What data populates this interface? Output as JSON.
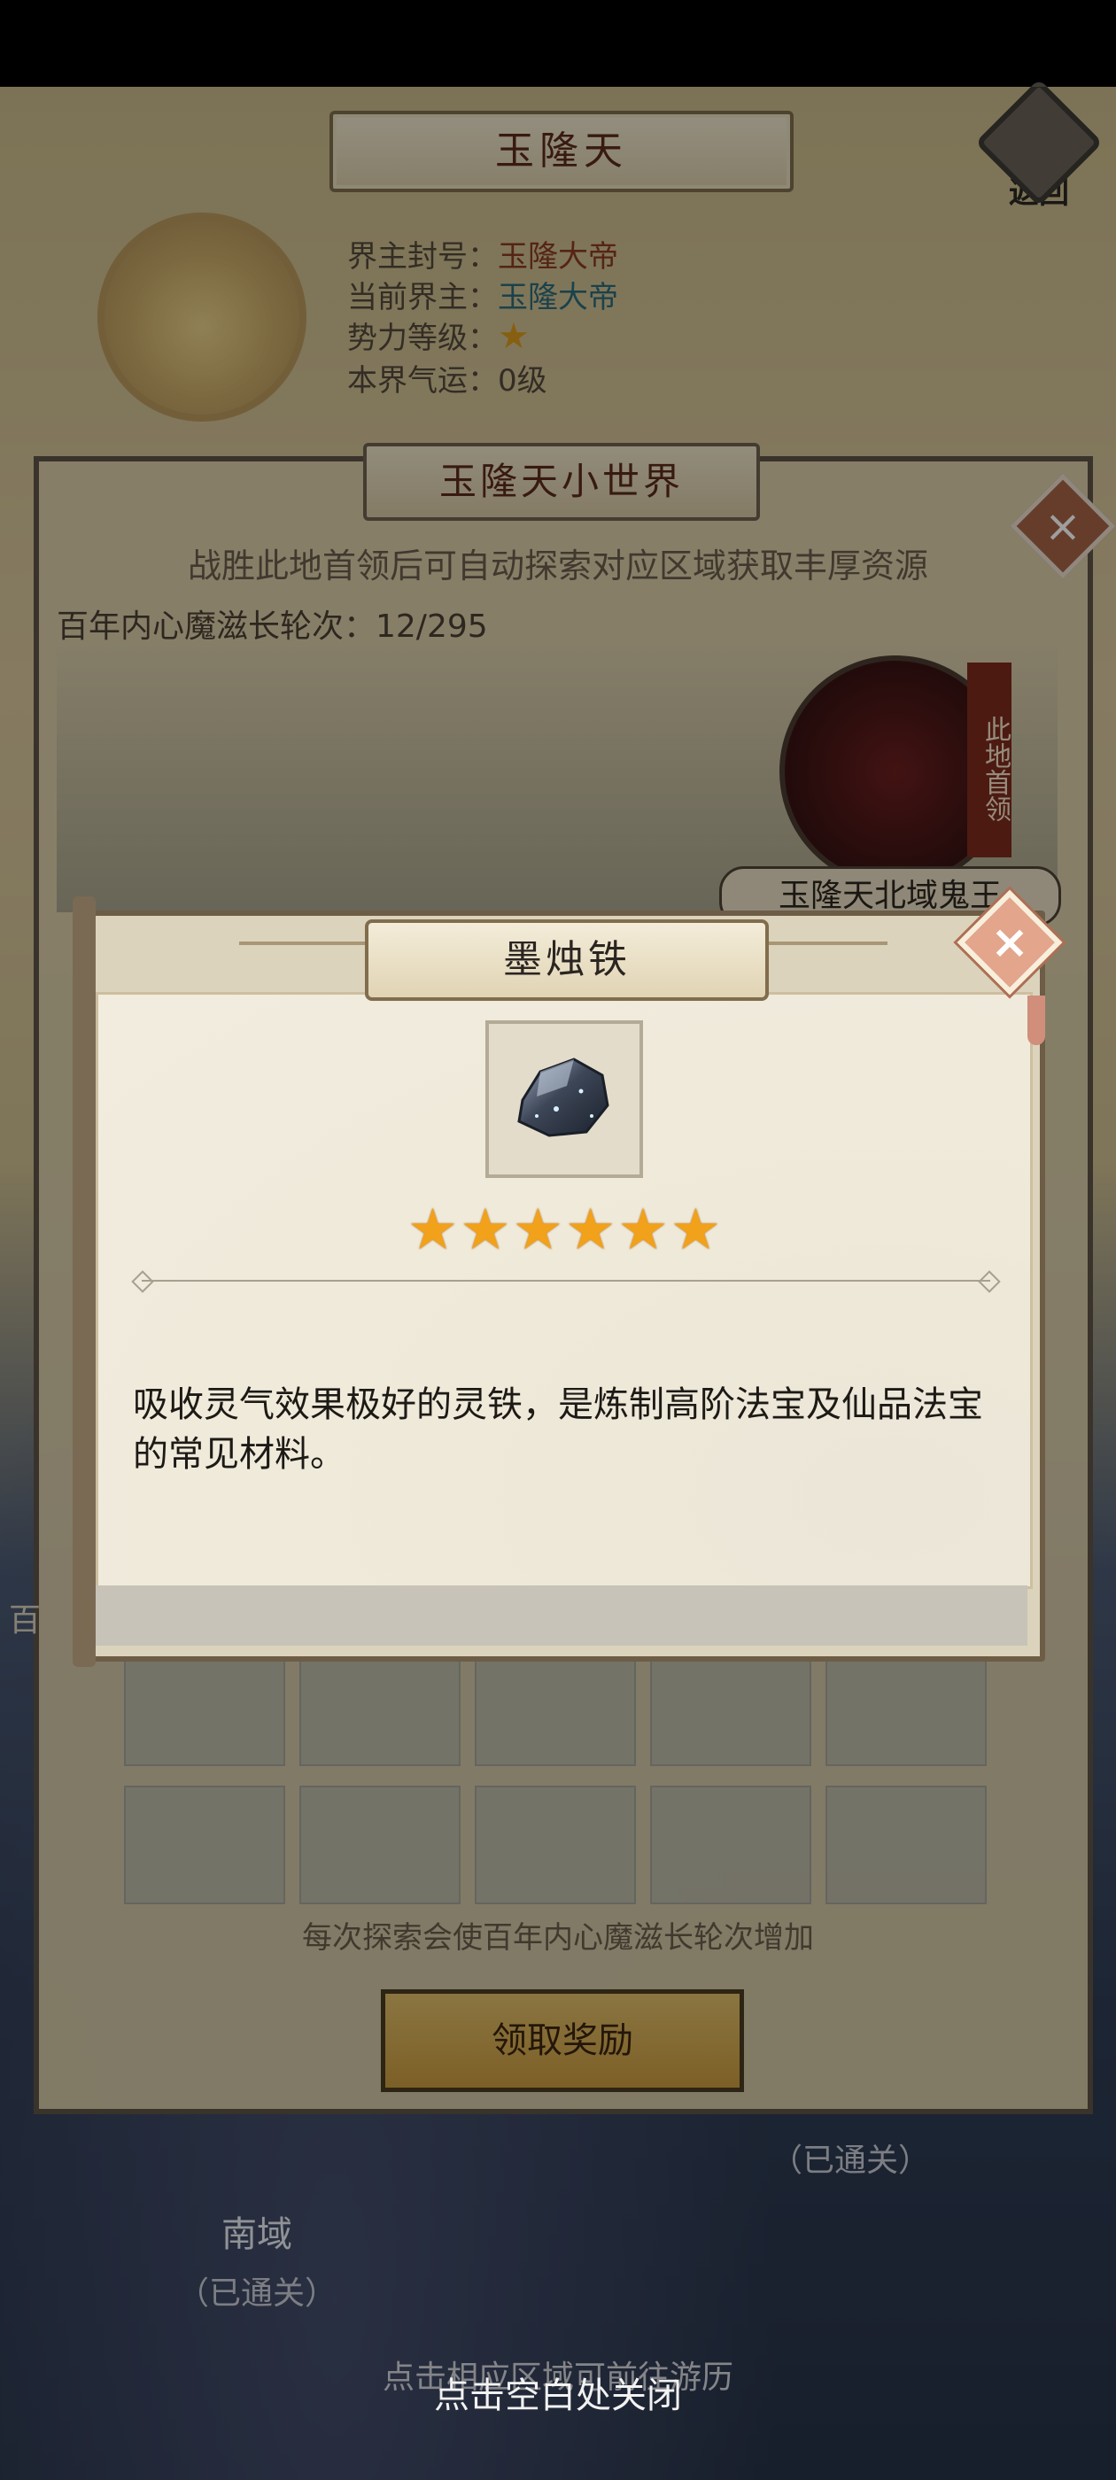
{
  "header": {
    "title": "玉隆天",
    "back_label": "返回"
  },
  "realm_info": {
    "title_label": "界主封号：",
    "title_value": "玉隆大帝",
    "lord_label": "当前界主：",
    "lord_value": "玉隆大帝",
    "level_label": "势力等级：",
    "level_stars": 1,
    "fortune_label": "本界气运：",
    "fortune_value": "0级"
  },
  "world_panel": {
    "title": "玉隆天小世界",
    "explore_text": "战胜此地首领后可自动探索对应区域获取丰厚资源",
    "rounds_label": "百年内心魔滋长轮次：12/295",
    "boss_side_label": "此地首领",
    "region_tag": "玉隆天北域鬼王",
    "hint": "每次探索会使百年内心魔滋长轮次增加",
    "reward_button": "领取奖励",
    "side_char": "百"
  },
  "map": {
    "south_label": "南域",
    "south_status": "（已通关）",
    "other_status": "（已通关）",
    "bottom_hint": "点击相应区域可前往游历"
  },
  "popup": {
    "item_name": "墨烛铁",
    "star_count": 6,
    "stars": "★★★★★★",
    "description": "吸收灵气效果极好的灵铁，是炼制高阶法宝及仙品法宝的常见材料。",
    "close_hint": "点击空白处关闭"
  },
  "colors": {
    "accent": "#5b2a1c",
    "star": "#f1a11a",
    "popup_bg": "#efe9d9"
  }
}
